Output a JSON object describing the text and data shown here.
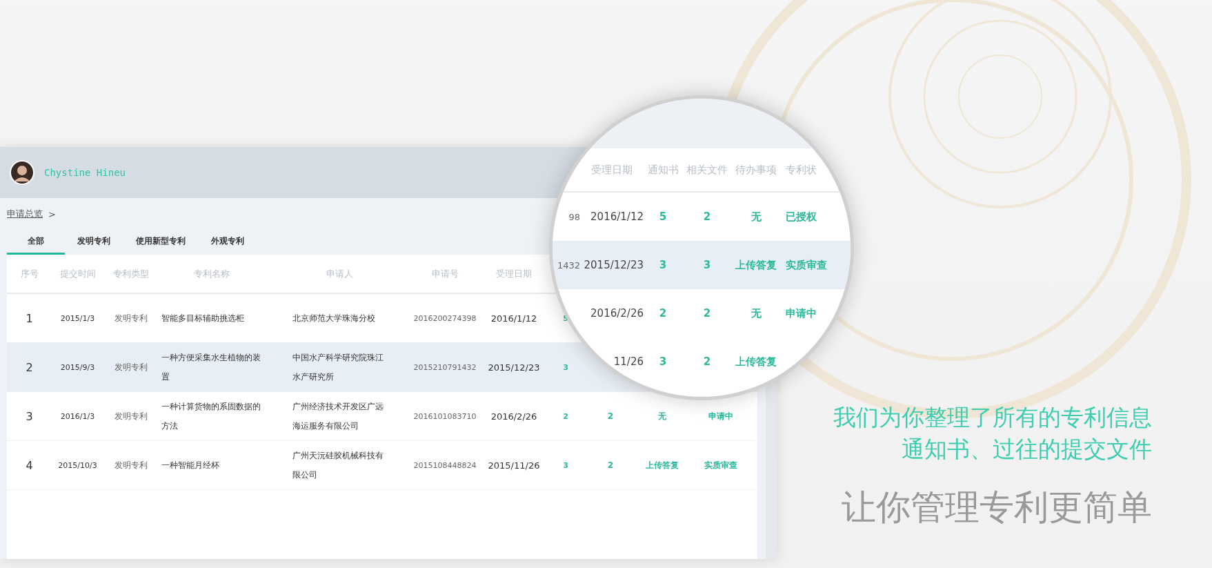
{
  "app_window": {
    "user_name": "Chystine Hineu",
    "breadcrumb": {
      "link": "申请总览",
      "separator": ">"
    },
    "tabs": [
      {
        "label": "全部",
        "selected": true
      },
      {
        "label": "发明专利",
        "selected": false
      },
      {
        "label": "使用新型专利",
        "selected": false
      },
      {
        "label": "外观专利",
        "selected": false
      }
    ],
    "table": {
      "columns": [
        "序号",
        "提交时间",
        "专利类型",
        "专利名称",
        "申请人",
        "申请号",
        "受理日期"
      ],
      "rows": [
        {
          "index": "1",
          "submitted": "2015/1/3",
          "type": "发明专利",
          "name": "智能多目标辅助挑选柜",
          "applicant": "北京师范大学珠海分校",
          "number": "2016200274398",
          "date": "2016/1/12",
          "notices": "5",
          "selected": false
        },
        {
          "index": "2",
          "submitted": "2015/9/3",
          "type": "发明专利",
          "name": "一种方便采集水生植物的装置",
          "applicant": "中国水产科学研究院珠江水产研究所",
          "number": "2015210791432",
          "date": "2015/12/23",
          "notices": "3",
          "selected": true
        },
        {
          "index": "3",
          "submitted": "2016/1/3",
          "type": "发明专利",
          "name": "一种计算货物的系固数据的方法",
          "applicant": "广州经济技术开发区广远海运服务有限公司",
          "number": "2016101083710",
          "date": "2016/2/26",
          "notices": "2",
          "files": "2",
          "todo": "无",
          "status": "申请中",
          "selected": false
        },
        {
          "index": "4",
          "submitted": "2015/10/3",
          "type": "发明专利",
          "name": "一种智能月经杯",
          "applicant": "广州天沅硅胶机械科技有限公司",
          "number": "2015108448824",
          "date": "2015/11/26",
          "notices": "3",
          "files": "2",
          "todo": "上传答复",
          "status": "实质审查",
          "selected": false
        }
      ]
    }
  },
  "magnifier": {
    "columns": [
      "受理日期",
      "通知书",
      "相关文件",
      "待办事项",
      "专利状"
    ],
    "rows": [
      {
        "number_tail": "98",
        "date": "2016/1/12",
        "notices": "5",
        "files": "2",
        "todo": "无",
        "status": "已授权",
        "selected": false
      },
      {
        "number_tail": "1432",
        "date": "2015/12/23",
        "notices": "3",
        "files": "3",
        "todo": "上传答复",
        "status": "实质审查",
        "selected": true
      },
      {
        "date": "2016/2/26",
        "notices": "2",
        "files": "2",
        "todo": "无",
        "status": "申请中",
        "selected": false
      },
      {
        "date": "11/26",
        "notices": "3",
        "files": "2",
        "todo": "上传答复",
        "selected": false
      }
    ]
  },
  "tagline": {
    "lines": [
      "我们为你整理了所有的专利信息",
      "通知书、过往的提交文件"
    ],
    "headline": "让你管理专利更简单"
  }
}
